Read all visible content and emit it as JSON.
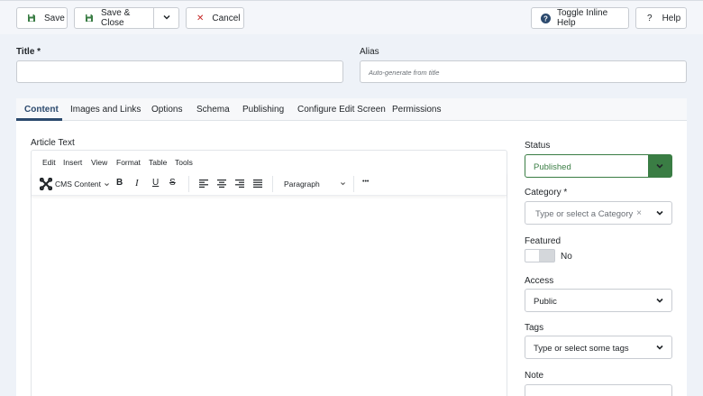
{
  "toolbar": {
    "save_label": "Save",
    "save_close_label": "Save & Close",
    "cancel_label": "Cancel",
    "toggle_help_label": "Toggle Inline Help",
    "help_label": "Help"
  },
  "form": {
    "title_label": "Title *",
    "title_value": "",
    "alias_label": "Alias",
    "alias_placeholder": "Auto-generate from title"
  },
  "tabs": [
    {
      "label": "Content",
      "active": true
    },
    {
      "label": "Images and Links"
    },
    {
      "label": "Options"
    },
    {
      "label": "Schema"
    },
    {
      "label": "Publishing"
    },
    {
      "label": "Configure Edit Screen"
    },
    {
      "label": "Permissions"
    }
  ],
  "editor": {
    "label": "Article Text",
    "menu": [
      "Edit",
      "Insert",
      "View",
      "Format",
      "Table",
      "Tools"
    ],
    "cms_content_label": "CMS Content",
    "format_select": "Paragraph",
    "more_icon": "•••",
    "icons": [
      "joomla-icon",
      "bold-icon",
      "italic-icon",
      "underline-icon",
      "strikethrough-icon",
      "align-left-icon",
      "align-center-icon",
      "align-right-icon",
      "align-justify-icon",
      "more-icon"
    ]
  },
  "sidebar": {
    "status_label": "Status",
    "status_value": "Published",
    "category_label": "Category *",
    "category_placeholder": "Type or select a Category",
    "category_clear": "×",
    "featured_label": "Featured",
    "featured_value": "No",
    "access_label": "Access",
    "access_value": "Public",
    "tags_label": "Tags",
    "tags_placeholder": "Type or select some tags",
    "note_label": "Note"
  },
  "colors": {
    "accent": "#2c4a6e",
    "success": "#3a7d44",
    "danger": "#c52827",
    "background": "#eef2f8"
  }
}
